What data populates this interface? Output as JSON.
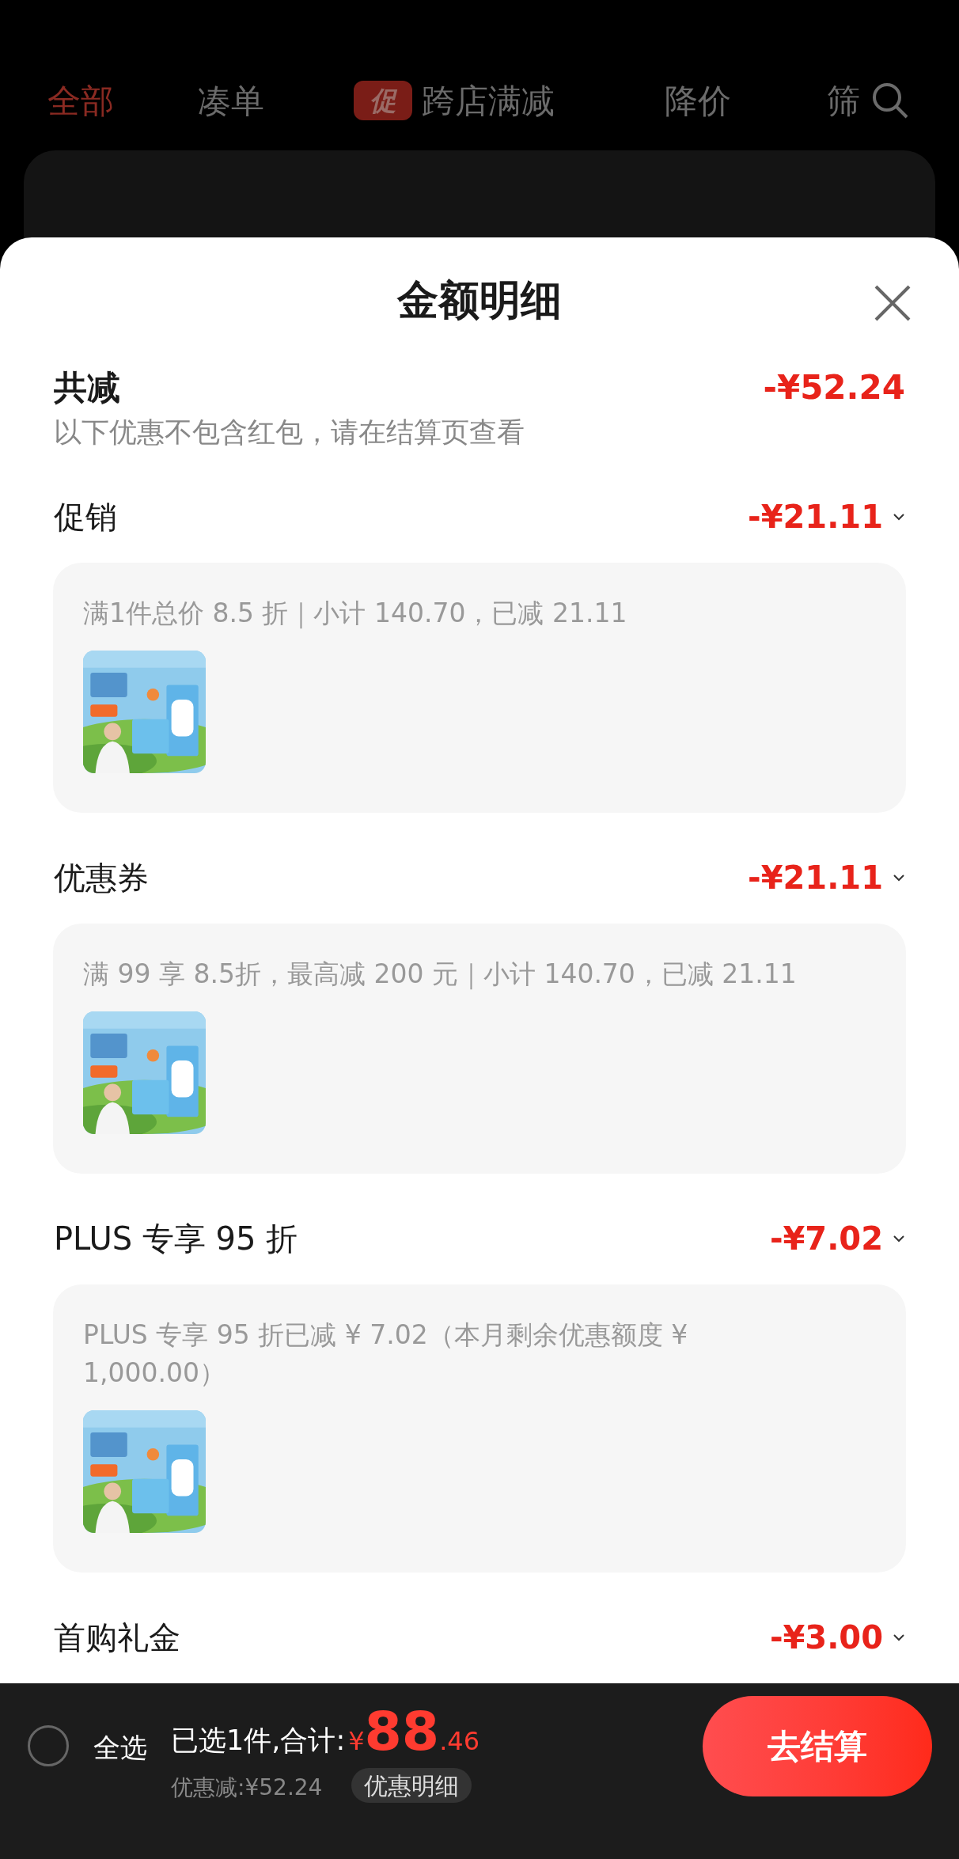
{
  "background": {
    "tabs": [
      {
        "label": "全部",
        "selected": true
      },
      {
        "label": "凑单",
        "selected": false
      },
      {
        "label": "跨店满减",
        "badge": "促",
        "selected": false
      },
      {
        "label": "降价",
        "selected": false
      },
      {
        "label": "筛",
        "selected": false
      }
    ]
  },
  "sheet": {
    "title": "金额明细",
    "total": {
      "label": "共减",
      "amount": "-¥52.24"
    },
    "note": "以下优惠不包含红包，请在结算页查看",
    "sections": [
      {
        "label": "促销",
        "amount": "-¥21.11",
        "detail": "满1件总价 8.5 折｜小计 140.70，已减 21.11"
      },
      {
        "label": "优惠券",
        "amount": "-¥21.11",
        "detail": "满 99 享 8.5折，最高减 200 元｜小计 140.70，已减 21.11"
      },
      {
        "label": "PLUS 专享 95 折",
        "amount": "-¥7.02",
        "detail": "PLUS 专享 95 折已减 ¥ 7.02（本月剩余优惠额度 ¥ 1,000.00）"
      },
      {
        "label": "首购礼金",
        "amount": "-¥3.00"
      }
    ]
  },
  "bottom_bar": {
    "select_all": {
      "label": "全选",
      "checked": false
    },
    "summary": "已选1件,合计:",
    "currency": "¥",
    "price_integer": "88",
    "price_decimal": ".46",
    "saving": "优惠减:¥52.24",
    "details_link": "优惠明细",
    "checkout": "去结算"
  }
}
